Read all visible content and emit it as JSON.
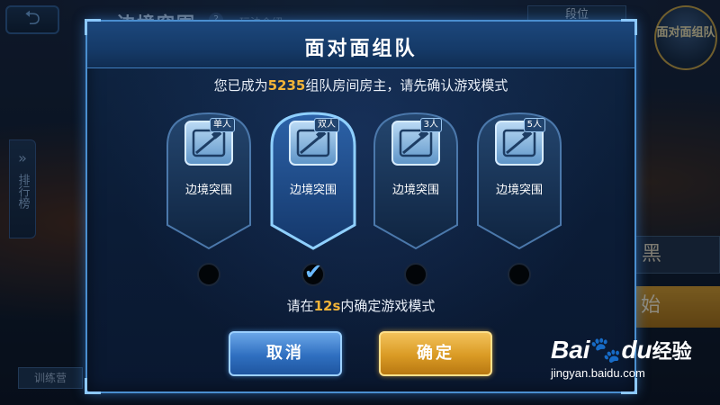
{
  "background": {
    "back_glyph": "⮌",
    "title": "边境突围",
    "help": "?",
    "subtitle": "玩法介绍",
    "rank_button": "段位",
    "f2f_badge": "面对面组队",
    "leaderboard": "排行榜",
    "leaderboard_arrow": "»",
    "right_button_1": "黑",
    "right_button_2": "始",
    "training_button": "训练营"
  },
  "modal": {
    "title": "面对面组队",
    "host_prefix": "您已成为",
    "room_code": "5235",
    "host_suffix": "组队房间房主，请先确认游戏模式",
    "modes": [
      {
        "tag": "单人",
        "label": "边境突围",
        "selected": false
      },
      {
        "tag": "双人",
        "label": "边境突围",
        "selected": true
      },
      {
        "tag": "3人",
        "label": "边境突围",
        "selected": false
      },
      {
        "tag": "5人",
        "label": "边境突围",
        "selected": false
      }
    ],
    "check_glyph": "✔",
    "timer_prefix": "请在",
    "timer_value": "12s",
    "timer_suffix": "内确定游戏模式",
    "cancel_label": "取消",
    "confirm_label": "确定"
  },
  "watermark": {
    "logo_left": "Bai",
    "logo_paw": "🐾",
    "logo_right": "du",
    "logo_cn": "经验",
    "url": "jingyan.baidu.com"
  },
  "colors": {
    "highlight": "#f1b338",
    "accent_blue": "#4a8ecf",
    "confirm_gold": "#d99a24"
  }
}
